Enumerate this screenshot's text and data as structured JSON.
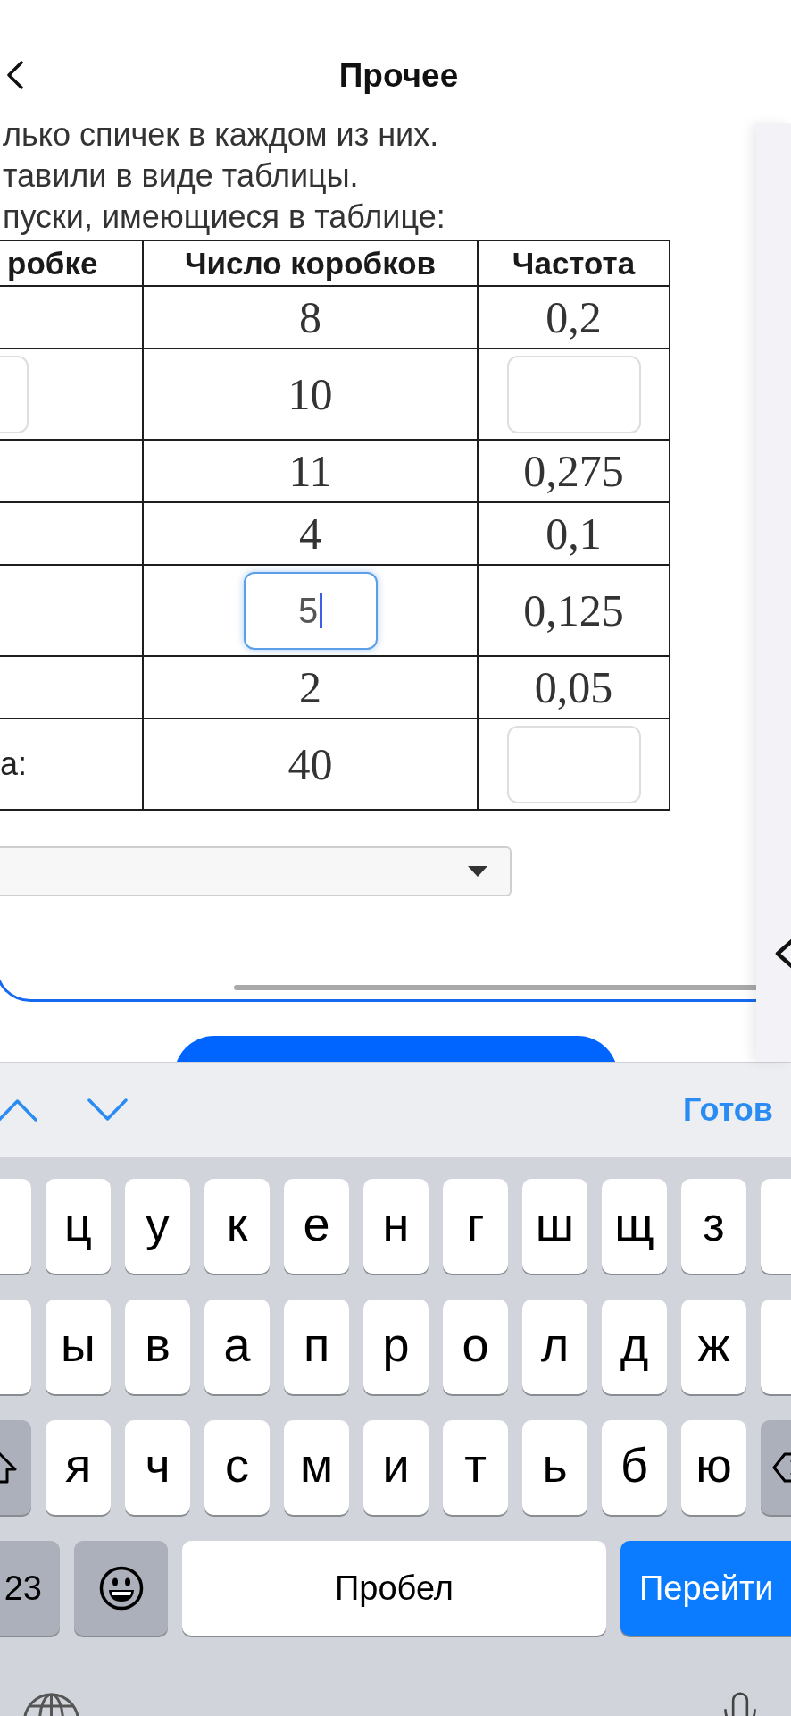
{
  "nav_bar": {
    "title": "Прочее"
  },
  "task": {
    "lines": [
      "лько спичек в каждом из них.",
      "тавили в виде таблицы.",
      "пуски, имеющиеся в таблице:"
    ],
    "table": {
      "columns": [
        "робке",
        "Число коробков",
        "Частота"
      ],
      "rows": [
        [
          {
            "kind": "blank"
          },
          {
            "kind": "text",
            "text": "8"
          },
          {
            "kind": "text",
            "text": "0,2"
          }
        ],
        [
          {
            "kind": "input",
            "focused": false
          },
          {
            "kind": "text",
            "text": "10"
          },
          {
            "kind": "input",
            "focused": false
          }
        ],
        [
          {
            "kind": "blank"
          },
          {
            "kind": "text",
            "text": "11"
          },
          {
            "kind": "text",
            "text": "0,275"
          }
        ],
        [
          {
            "kind": "blank"
          },
          {
            "kind": "text",
            "text": "4"
          },
          {
            "kind": "text",
            "text": "0,1"
          }
        ],
        [
          {
            "kind": "blank"
          },
          {
            "kind": "input",
            "value": "5",
            "focused": true
          },
          {
            "kind": "text",
            "text": "0,125"
          }
        ],
        [
          {
            "kind": "blank"
          },
          {
            "kind": "text",
            "text": "2"
          },
          {
            "kind": "text",
            "text": "0,05"
          }
        ],
        [
          {
            "kind": "text",
            "text": "а:"
          },
          {
            "kind": "text",
            "text": "40"
          },
          {
            "kind": "input",
            "focused": false
          }
        ]
      ]
    }
  },
  "keyboard_toolbar": {
    "done_label": "Готов"
  },
  "keyboard": {
    "letter_rows": [
      [
        {
          "kind": "letter"
        },
        {
          "kind": "letter",
          "label": "ц"
        },
        {
          "kind": "letter",
          "label": "у"
        },
        {
          "kind": "letter",
          "label": "к"
        },
        {
          "kind": "letter",
          "label": "е"
        },
        {
          "kind": "letter",
          "label": "н"
        },
        {
          "kind": "letter",
          "label": "г"
        },
        {
          "kind": "letter",
          "label": "ш"
        },
        {
          "kind": "letter",
          "label": "щ"
        },
        {
          "kind": "letter",
          "label": "з"
        },
        {
          "kind": "letter"
        }
      ],
      [
        {
          "kind": "letter"
        },
        {
          "kind": "letter",
          "label": "ы"
        },
        {
          "kind": "letter",
          "label": "в"
        },
        {
          "kind": "letter",
          "label": "а"
        },
        {
          "kind": "letter",
          "label": "п"
        },
        {
          "kind": "letter",
          "label": "р"
        },
        {
          "kind": "letter",
          "label": "о"
        },
        {
          "kind": "letter",
          "label": "л"
        },
        {
          "kind": "letter",
          "label": "д"
        },
        {
          "kind": "letter",
          "label": "ж"
        },
        {
          "kind": "letter"
        }
      ],
      [
        {
          "kind": "shift"
        },
        {
          "kind": "letter",
          "label": "я"
        },
        {
          "kind": "letter",
          "label": "ч"
        },
        {
          "kind": "letter",
          "label": "с"
        },
        {
          "kind": "letter",
          "label": "м"
        },
        {
          "kind": "letter",
          "label": "и"
        },
        {
          "kind": "letter",
          "label": "т"
        },
        {
          "kind": "letter",
          "label": "ь"
        },
        {
          "kind": "letter",
          "label": "б"
        },
        {
          "kind": "letter",
          "label": "ю"
        },
        {
          "kind": "delete"
        }
      ]
    ],
    "bottom_row": [
      {
        "kind": "mode",
        "label": "23"
      },
      {
        "kind": "emoji"
      },
      {
        "kind": "space",
        "label": "Пробел"
      },
      {
        "kind": "go",
        "label": "Перейти"
      }
    ]
  }
}
